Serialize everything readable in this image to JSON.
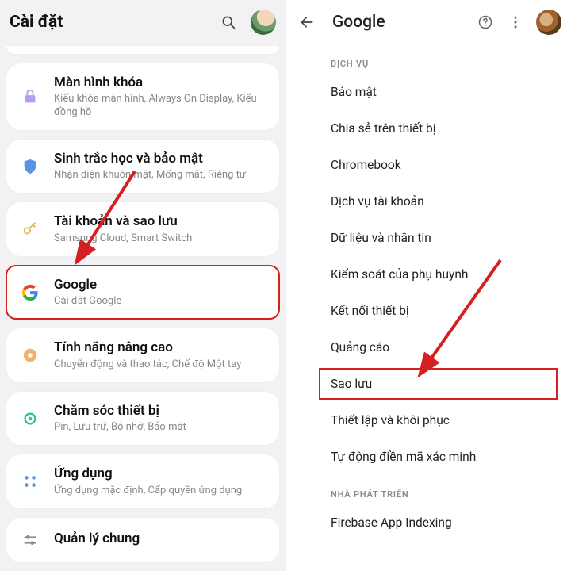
{
  "left": {
    "header_title": "Cài đặt",
    "items": [
      {
        "icon": "grid-partial",
        "title": "",
        "sub": ""
      },
      {
        "icon": "lock",
        "title": "Màn hình khóa",
        "sub": "Kiểu khóa màn hình, Always On Display, Kiểu đồng hồ"
      },
      {
        "icon": "shield",
        "title": "Sinh trắc học và bảo mật",
        "sub": "Nhận diện khuôn mặt, Mống mắt, Riêng tư"
      },
      {
        "icon": "key",
        "title": "Tài khoản và sao lưu",
        "sub": "Samsung Cloud, Smart Switch"
      },
      {
        "icon": "google-g",
        "title": "Google",
        "sub": "Cài đặt Google",
        "highlight": true
      },
      {
        "icon": "gear-badge",
        "title": "Tính năng nâng cao",
        "sub": "Chuyển động và thao tác, Chế độ Một tay"
      },
      {
        "icon": "care",
        "title": "Chăm sóc thiết bị",
        "sub": "Pin, Lưu trữ, Bộ nhớ, Bảo mật"
      },
      {
        "icon": "apps",
        "title": "Ứng dụng",
        "sub": "Ứng dụng mặc định, Cấp quyền ứng dụng"
      },
      {
        "icon": "sliders",
        "title": "Quản lý chung",
        "sub": ""
      }
    ]
  },
  "right": {
    "header_title": "Google",
    "sections": [
      {
        "label": "DỊCH VỤ",
        "items": [
          {
            "label": "Bảo mật"
          },
          {
            "label": "Chia sẻ trên thiết bị"
          },
          {
            "label": "Chromebook"
          },
          {
            "label": "Dịch vụ tài khoản"
          },
          {
            "label": "Dữ liệu và nhắn tin"
          },
          {
            "label": "Kiểm soát của phụ huynh"
          },
          {
            "label": "Kết nối thiết bị"
          },
          {
            "label": "Quảng cáo"
          },
          {
            "label": "Sao lưu",
            "highlight": true
          },
          {
            "label": "Thiết lập và khôi phục"
          },
          {
            "label": "Tự động điền mã xác minh"
          }
        ]
      },
      {
        "label": "NHÀ PHÁT TRIỂN",
        "items": [
          {
            "label": "Firebase App Indexing"
          }
        ]
      }
    ]
  },
  "annotations": {
    "highlight_color": "#d42020"
  }
}
